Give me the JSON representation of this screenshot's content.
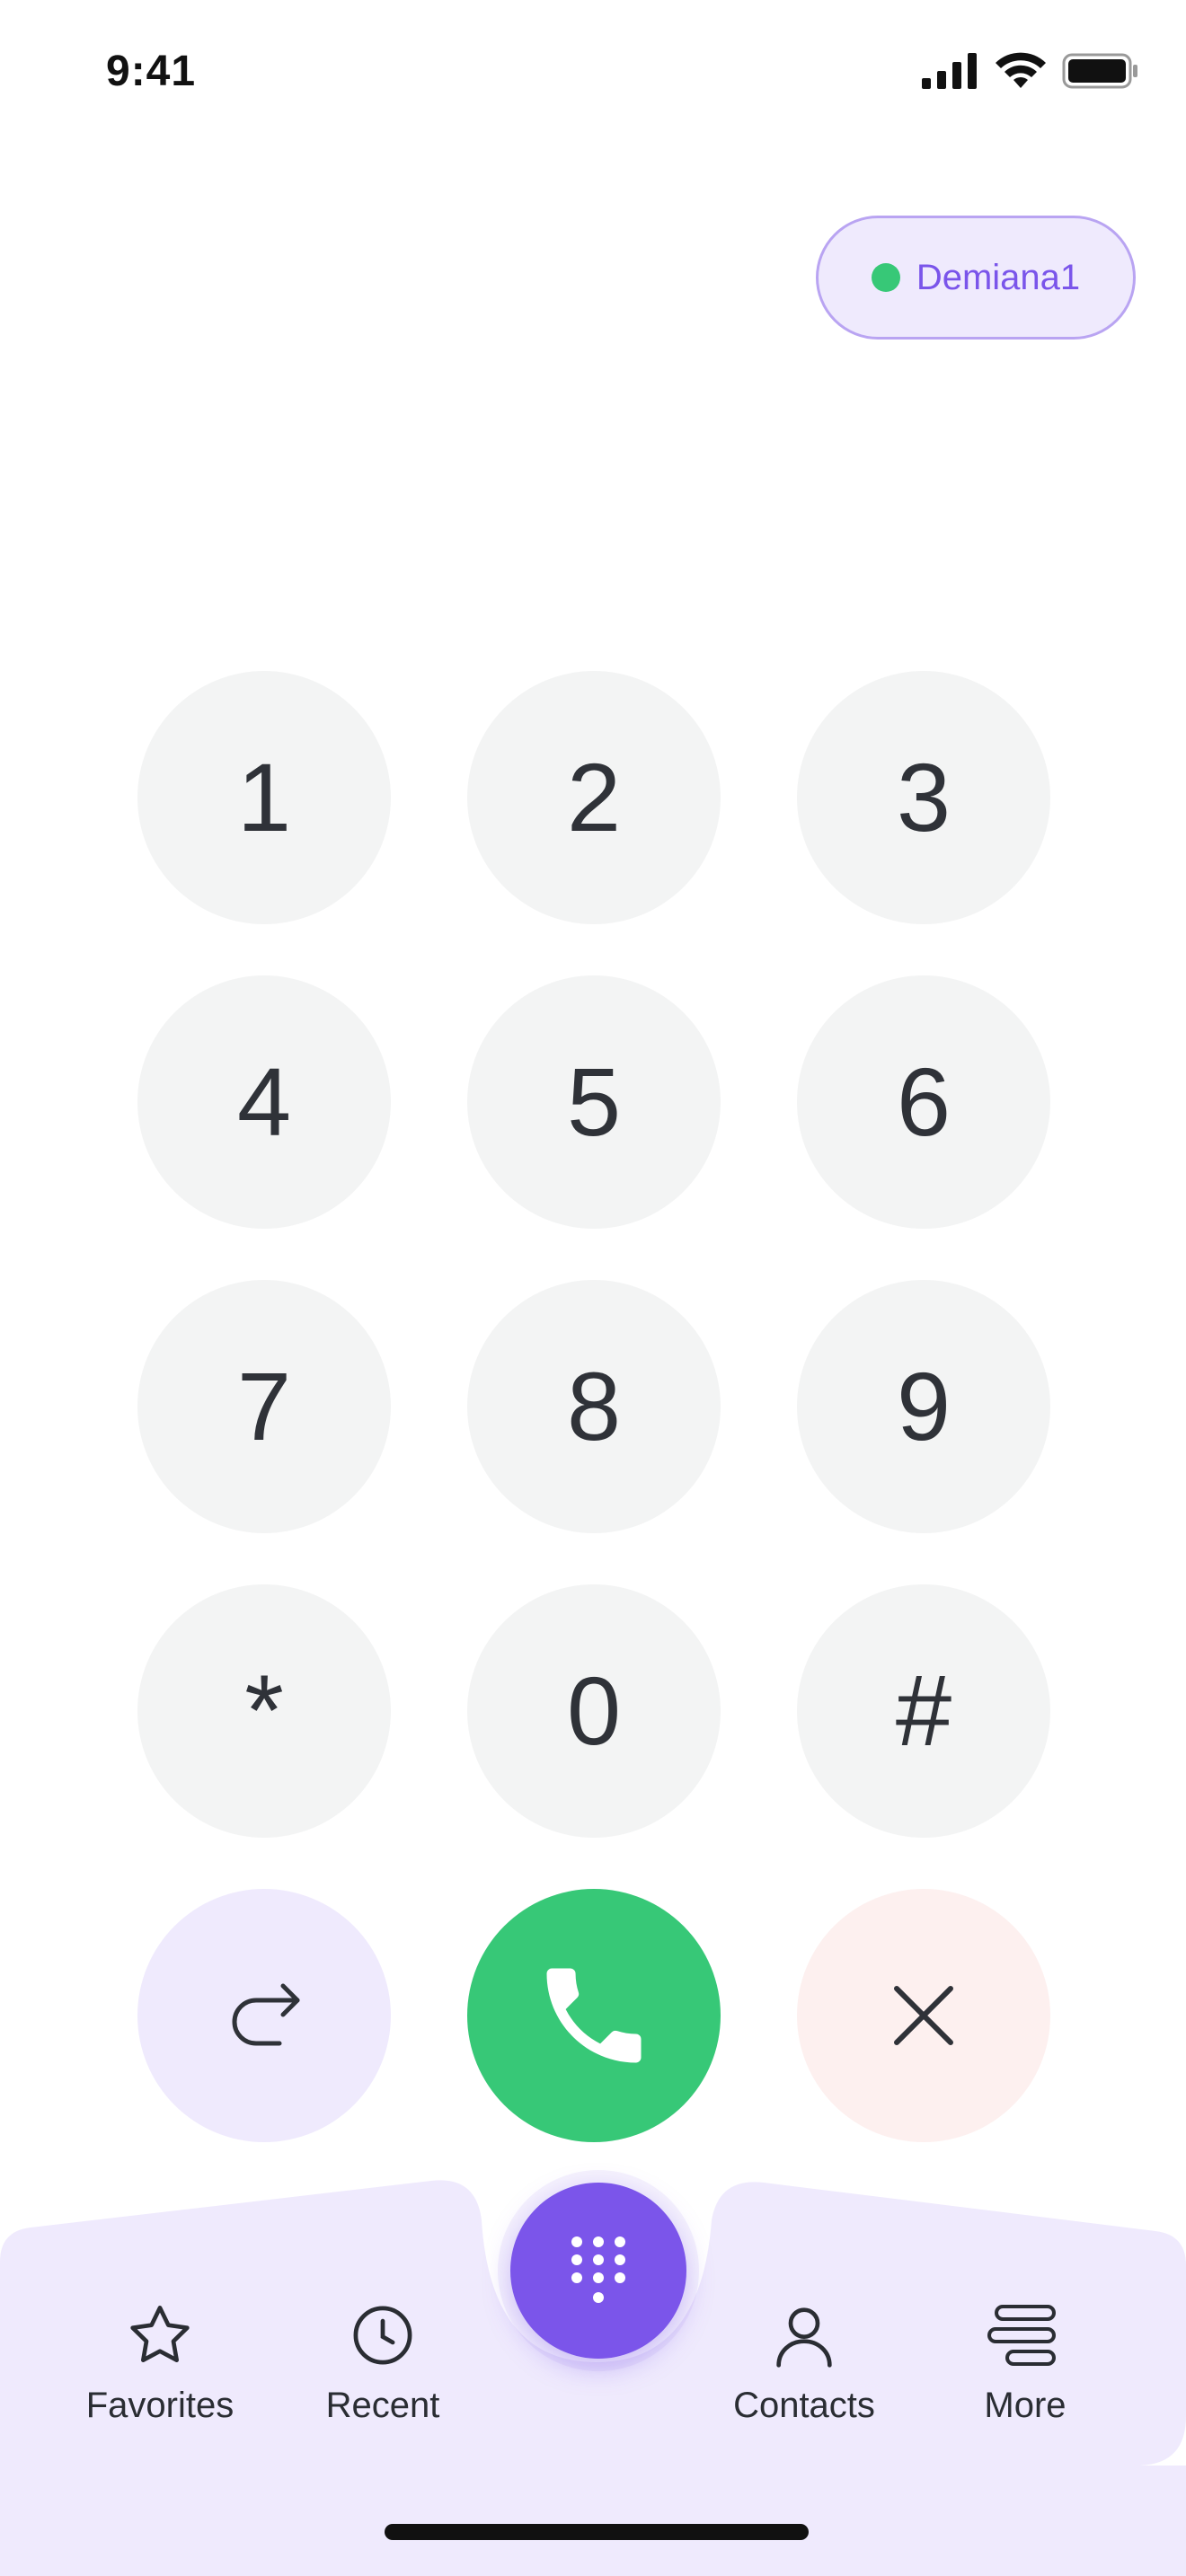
{
  "status_bar": {
    "time": "9:41",
    "icons": [
      "cellular-signal-icon",
      "wifi-icon",
      "battery-icon"
    ]
  },
  "account": {
    "username": "Demiana1",
    "status_color": "#37c877"
  },
  "keypad": {
    "keys": [
      {
        "label": "1"
      },
      {
        "label": "2"
      },
      {
        "label": "3"
      },
      {
        "label": "4"
      },
      {
        "label": "5"
      },
      {
        "label": "6"
      },
      {
        "label": "7"
      },
      {
        "label": "8"
      },
      {
        "label": "9"
      },
      {
        "label": "*"
      },
      {
        "label": "0"
      },
      {
        "label": "#"
      }
    ],
    "actions": {
      "redial_icon": "redial-arrow-icon",
      "call_icon": "phone-icon",
      "clear_icon": "close-icon"
    }
  },
  "tabbar": {
    "tabs": [
      {
        "label": "Favorites",
        "icon": "star-icon"
      },
      {
        "label": "Recent",
        "icon": "clock-icon"
      },
      {
        "label": "Contacts",
        "icon": "person-icon"
      },
      {
        "label": "More",
        "icon": "menu-lines-icon"
      }
    ],
    "center_icon": "dialpad-icon"
  },
  "colors": {
    "accent": "#7b55ea",
    "call": "#37c877",
    "key_bg": "#f3f4f4",
    "tabbar_bg": "#efeafd",
    "clear_bg": "#fdf0ef"
  }
}
